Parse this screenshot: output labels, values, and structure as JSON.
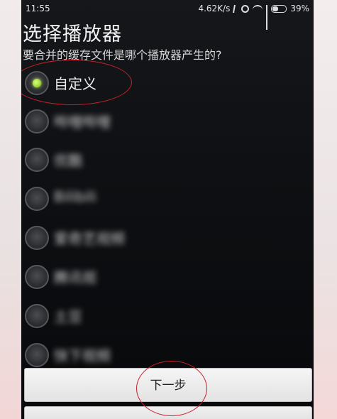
{
  "status_bar": {
    "time": "11:55",
    "network_speed": "4.62K/s",
    "battery": "39%",
    "icons": [
      "bluetooth-icon",
      "alarm-icon",
      "wifi-icon",
      "signal-icon",
      "battery-icon"
    ]
  },
  "dialog": {
    "title": "选择播放器",
    "subtitle": "要合并的缓存文件是哪个播放器产生的?",
    "options": [
      {
        "label": "自定义",
        "selected": true,
        "blurred": false
      },
      {
        "label": "哔哩哔哩",
        "selected": false,
        "blurred": true
      },
      {
        "label": "优酷",
        "selected": false,
        "blurred": true
      },
      {
        "label": "Bilibili",
        "selected": false,
        "blurred": true
      },
      {
        "label": "爱奇艺视频",
        "selected": false,
        "blurred": true
      },
      {
        "label": "腾讯视",
        "selected": false,
        "blurred": true
      },
      {
        "label": "土豆",
        "selected": false,
        "blurred": true
      },
      {
        "label": "快下视频",
        "selected": false,
        "blurred": true
      }
    ],
    "next_button": "下一步"
  },
  "colors": {
    "accent_radio": "#9ad233",
    "annotation": "#c8202a",
    "background": "#0e1013"
  }
}
